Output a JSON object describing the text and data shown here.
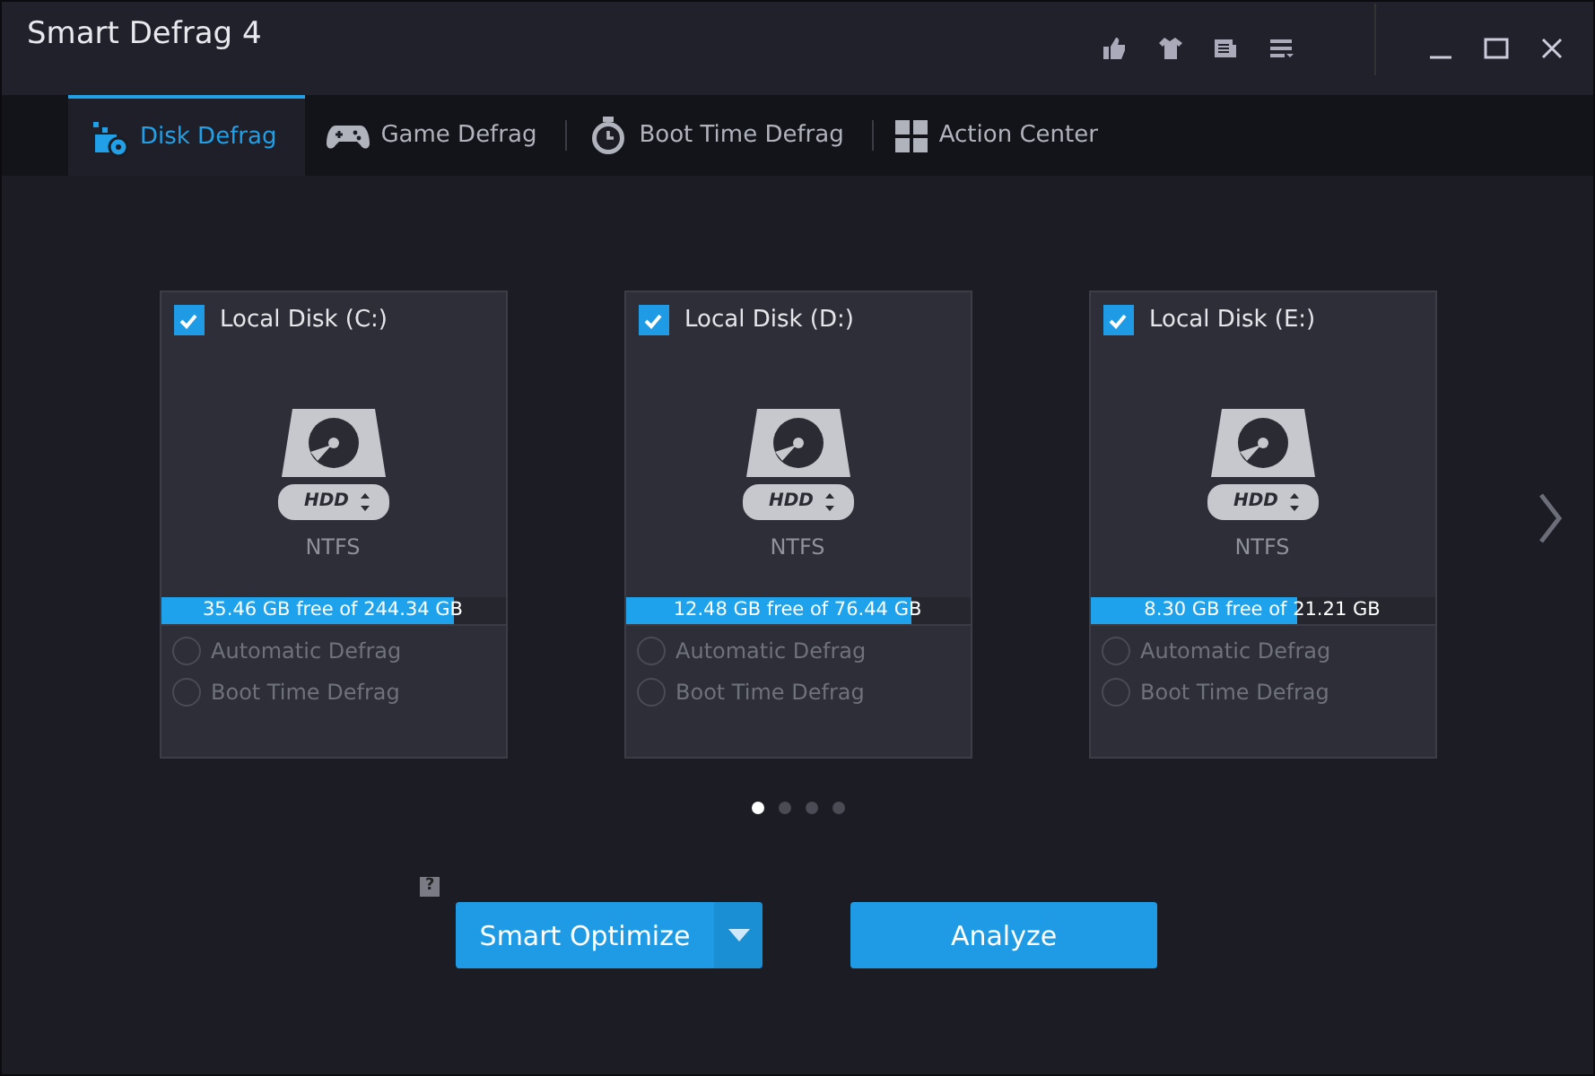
{
  "window": {
    "title": "Smart Defrag 4"
  },
  "tabs": [
    {
      "label": "Disk Defrag",
      "selected": true
    },
    {
      "label": "Game Defrag",
      "selected": false
    },
    {
      "label": "Boot Time Defrag",
      "selected": false
    },
    {
      "label": "Action Center",
      "selected": false
    }
  ],
  "disks": [
    {
      "name": "Local Disk (C:)",
      "checked": true,
      "type": "HDD",
      "file_system": "NTFS",
      "usage": "35.46 GB free of 244.34 GB",
      "level": 0.85,
      "options": [
        {
          "label": "Automatic Defrag",
          "selected": false
        },
        {
          "label": "Boot Time Defrag",
          "selected": false
        }
      ]
    },
    {
      "name": "Local Disk (D:)",
      "checked": true,
      "type": "HDD",
      "file_system": "NTFS",
      "usage": "12.48 GB free of 76.44 GB",
      "level": 0.83,
      "options": [
        {
          "label": "Automatic Defrag",
          "selected": false
        },
        {
          "label": "Boot Time Defrag",
          "selected": false
        }
      ]
    },
    {
      "name": "Local Disk (E:)",
      "checked": true,
      "type": "HDD",
      "file_system": "NTFS",
      "usage": "8.30 GB free of 21.21 GB",
      "level": 0.6,
      "options": [
        {
          "label": "Automatic Defrag",
          "selected": false
        },
        {
          "label": "Boot Time Defrag",
          "selected": false
        }
      ]
    }
  ],
  "pages": [
    {
      "selected": true
    },
    {
      "selected": false
    },
    {
      "selected": false
    },
    {
      "selected": false
    }
  ],
  "help": "?",
  "buttons": {
    "primary": "Smart Optimize",
    "secondary": "Analyze"
  }
}
